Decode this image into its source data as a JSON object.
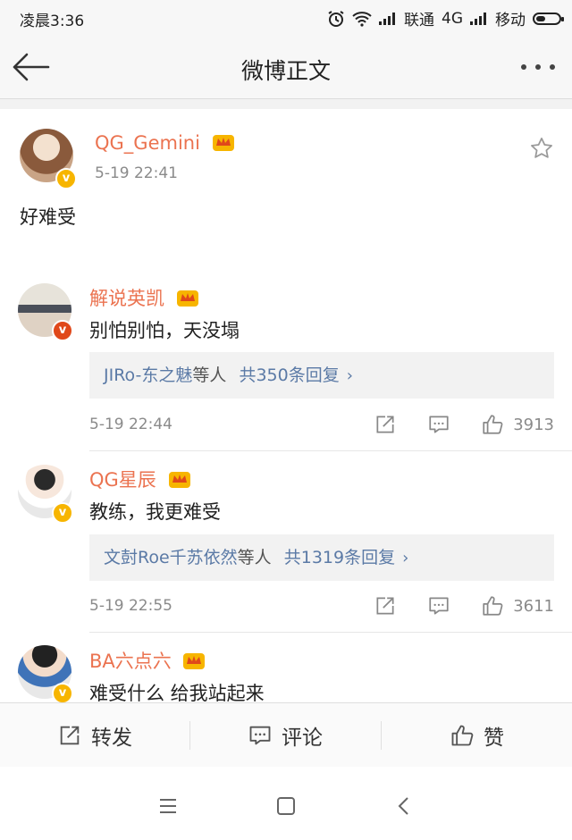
{
  "status_bar": {
    "time": "凌晨3:36",
    "carrier1": "联通",
    "network": "4G",
    "carrier2": "移动"
  },
  "header": {
    "title": "微博正文"
  },
  "post": {
    "author": "QG_Gemini",
    "time": "5-19 22:41",
    "text": "好难受"
  },
  "comments": [
    {
      "author": "解说英凯",
      "text": "别怕别怕，天没塌",
      "reply_who": "JIRo-东之魅",
      "reply_mid": "等人",
      "reply_total": "共350条回复",
      "time": "5-19 22:44",
      "likes": "3913",
      "badge": "red"
    },
    {
      "author": "QG星辰",
      "text": "教练，我更难受",
      "reply_who": "文尌Roe千苏依然",
      "reply_mid": "等人",
      "reply_total": "共1319条回复",
      "time": "5-19 22:55",
      "likes": "3611",
      "badge": "gold"
    },
    {
      "author": "BA六点六",
      "text": "难受什么 给我站起来",
      "badge": "gold"
    }
  ],
  "bottom_bar": {
    "repost": "转发",
    "comment": "评论",
    "like": "赞"
  },
  "colors": {
    "username": "#eb7350",
    "link": "#5b7aa6",
    "vip_gold": "#f7b500",
    "vip_red": "#e0481a"
  },
  "icons": [
    "back-arrow-icon",
    "more-dots-icon",
    "star-icon",
    "crown-icon",
    "share-icon",
    "comment-icon",
    "like-icon",
    "menu-icon",
    "home-icon",
    "back-nav-icon"
  ]
}
